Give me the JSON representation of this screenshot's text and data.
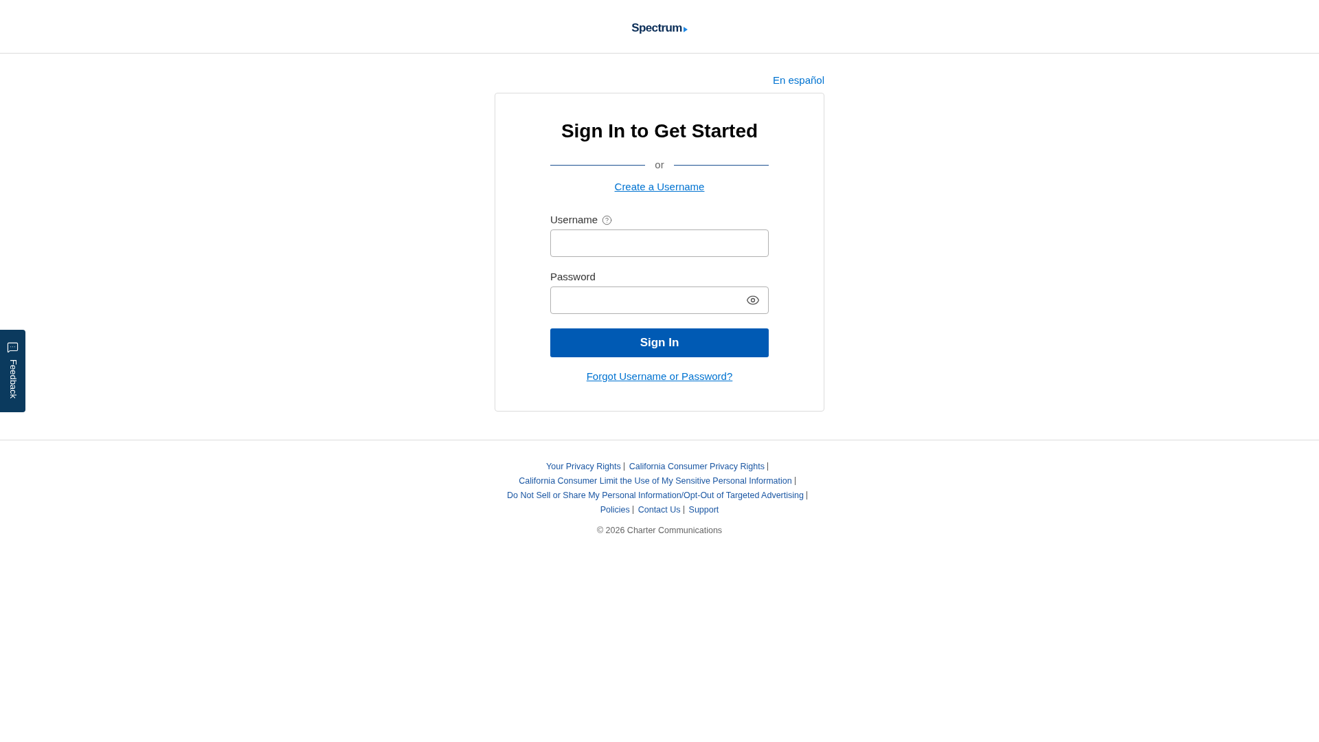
{
  "header": {
    "logo": "Spectrum"
  },
  "language_link": "En español",
  "sign_in": {
    "title": "Sign In to Get Started",
    "divider_text": "or",
    "create_username_link": "Create a Username",
    "fields": [
      {
        "kind": "text",
        "label": "Username"
      },
      {
        "kind": "password",
        "label": "Password"
      }
    ],
    "submit_button": "Sign In",
    "forgot_link": "Forgot Username or Password?"
  },
  "footer": {
    "links": [
      "Your Privacy Rights",
      "California Consumer Privacy Rights",
      "California Consumer Limit the Use of My Sensitive Personal Information",
      "Do Not Sell or Share My Personal Information/Opt-Out of Targeted Advertising",
      "Policies",
      "Contact Us",
      "Support"
    ],
    "copyright": "© 2026 Charter Communications"
  },
  "feedback_tab": {
    "label": "Feedback"
  }
}
